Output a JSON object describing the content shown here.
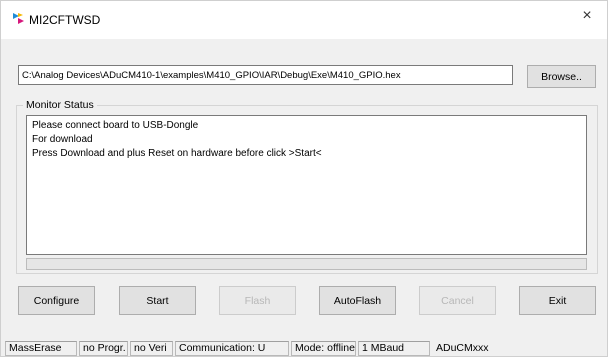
{
  "window": {
    "title": "MI2CFTWSD",
    "close_symbol": "×",
    "icon": "app-logo-icon"
  },
  "file": {
    "path": "C:\\Analog Devices\\ADuCM410-1\\examples\\M410_GPIO\\IAR\\Debug\\Exe\\M410_GPIO.hex",
    "browse_label": "Browse.."
  },
  "monitor": {
    "group_label": "Monitor Status",
    "lines": [
      "Please connect board to USB-Dongle",
      "For download",
      "Press Download and plus Reset on hardware before click >Start<"
    ],
    "progress": 0
  },
  "buttons": {
    "configure": "Configure",
    "start": "Start",
    "flash": "Flash",
    "autoflash": "AutoFlash",
    "cancel": "Cancel",
    "exit": "Exit"
  },
  "statusbar": [
    "MassErase",
    "no Progr.",
    "no Veri",
    "Communication: U",
    "Mode: offline",
    "1 MBaud",
    "ADuCMxxx"
  ],
  "colors": {
    "window_bg": "#f0f0f0",
    "titlebar_bg": "#ffffff",
    "disabled_text": "#b7b7b7",
    "logo_blue": "#1e8bd6",
    "logo_yellow": "#f5b800",
    "logo_magenta": "#d6187d"
  }
}
